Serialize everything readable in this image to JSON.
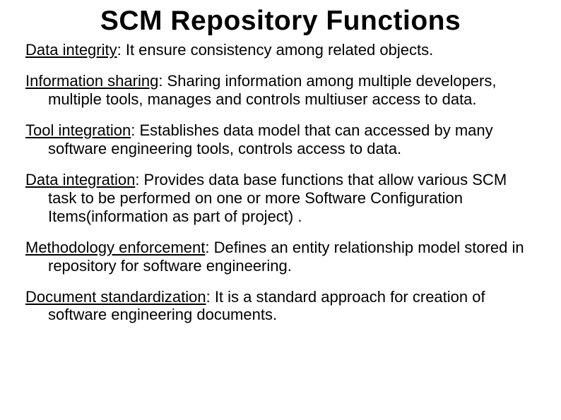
{
  "title": "SCM Repository Functions",
  "items": [
    {
      "term": "Data integrity",
      "desc": ": It ensure consistency among related objects."
    },
    {
      "term": "Information sharing",
      "desc": ": Sharing information among multiple developers, multiple tools, manages and controls multiuser access to data."
    },
    {
      "term": "Tool integration",
      "desc": ": Establishes data model that can accessed by many software engineering tools, controls access to data."
    },
    {
      "term": "Data integration",
      "desc": ": Provides data base functions that allow various SCM task to be performed on one or more Software Configuration Items(information as part of project) ."
    },
    {
      "term": "Methodology enforcement",
      "desc": ": Defines an entity relationship model stored in repository for software engineering."
    },
    {
      "term": "Document standardization",
      "desc": ": It is a standard approach for creation of software engineering documents."
    }
  ]
}
